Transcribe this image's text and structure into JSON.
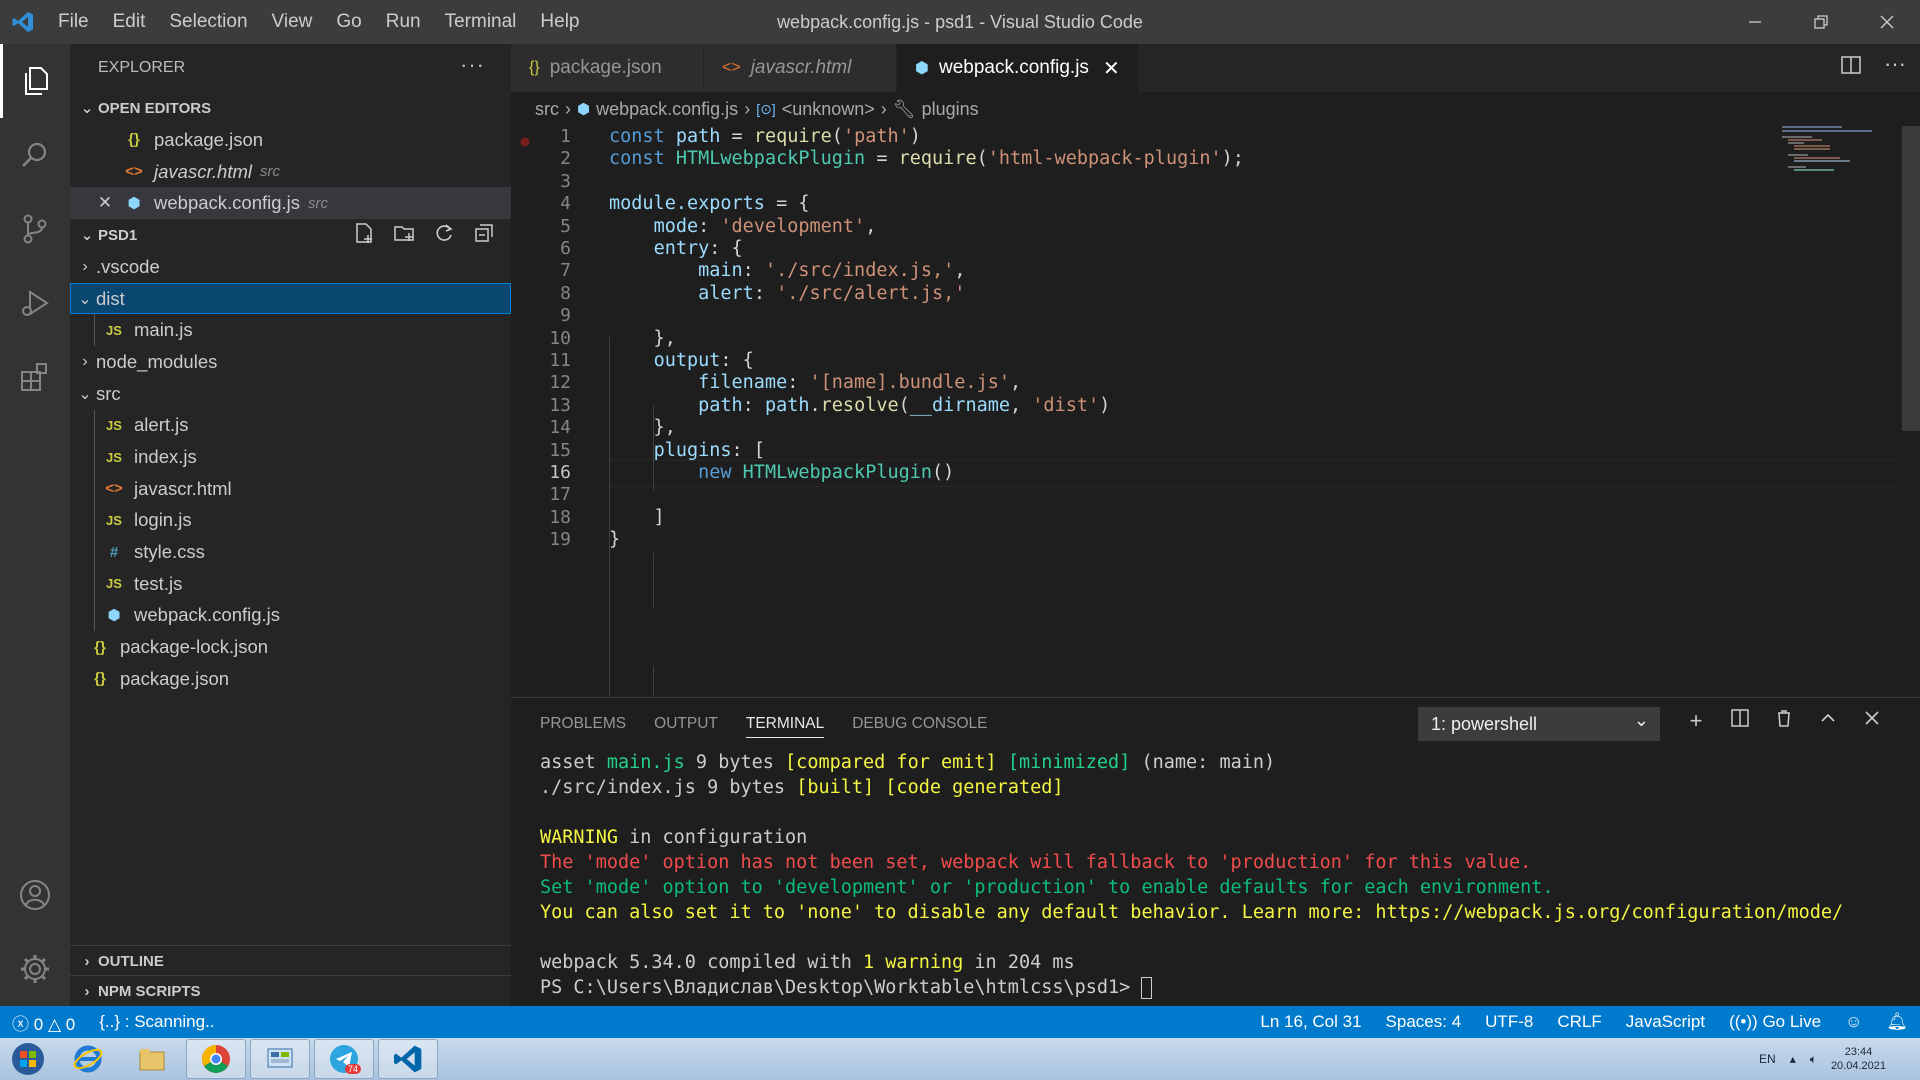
{
  "window": {
    "title": "webpack.config.js - psd1 - Visual Studio Code",
    "menu": [
      "File",
      "Edit",
      "Selection",
      "View",
      "Go",
      "Run",
      "Terminal",
      "Help"
    ]
  },
  "explorer": {
    "header": "EXPLORER",
    "open_editors_label": "OPEN EDITORS",
    "open_editors": [
      {
        "name": "package.json",
        "desc": "",
        "icon": "json"
      },
      {
        "name": "javascr.html",
        "desc": "src",
        "icon": "html"
      },
      {
        "name": "webpack.config.js",
        "desc": "src",
        "icon": "webpack"
      }
    ],
    "project_label": "PSD1",
    "tree": [
      {
        "name": ".vscode",
        "kind": "folder-closed"
      },
      {
        "name": "dist",
        "kind": "folder-open"
      },
      {
        "name": "main.js",
        "kind": "js"
      },
      {
        "name": "node_modules",
        "kind": "folder-closed"
      },
      {
        "name": "src",
        "kind": "folder-open"
      },
      {
        "name": "alert.js",
        "kind": "js"
      },
      {
        "name": "index.js",
        "kind": "js"
      },
      {
        "name": "javascr.html",
        "kind": "html"
      },
      {
        "name": "login.js",
        "kind": "js"
      },
      {
        "name": "style.css",
        "kind": "css"
      },
      {
        "name": "test.js",
        "kind": "js"
      },
      {
        "name": "webpack.config.js",
        "kind": "webpack"
      },
      {
        "name": "package-lock.json",
        "kind": "json"
      },
      {
        "name": "package.json",
        "kind": "json"
      }
    ],
    "outline_label": "OUTLINE",
    "npm_label": "NPM SCRIPTS"
  },
  "tabs": [
    {
      "name": "package.json",
      "icon": "json"
    },
    {
      "name": "javascr.html",
      "icon": "html"
    },
    {
      "name": "webpack.config.js",
      "icon": "webpack"
    }
  ],
  "breadcrumb": [
    "src",
    "webpack.config.js",
    "<unknown>",
    "plugins"
  ],
  "code": {
    "line_numbers": [
      "1",
      "2",
      "3",
      "4",
      "5",
      "6",
      "7",
      "8",
      "9",
      "10",
      "11",
      "12",
      "13",
      "14",
      "15",
      "16",
      "17",
      "18",
      "19"
    ],
    "lines": [
      "const path = require('path')",
      "const HTMLwebpackPlugin = require('html-webpack-plugin');",
      "",
      "module.exports = {",
      "    mode: 'development',",
      "    entry: {",
      "        main: './src/index.js,',",
      "        alert: './src/alert.js,'",
      "",
      "    },",
      "    output: {",
      "        filename: '[name].bundle.js',",
      "        path: path.resolve(__dirname, 'dist')",
      "    },",
      "    plugins: [",
      "        new HTMLwebpackPlugin()",
      "",
      "    ]",
      "}"
    ]
  },
  "panel": {
    "tabs": [
      "PROBLEMS",
      "OUTPUT",
      "TERMINAL",
      "DEBUG CONSOLE"
    ],
    "terminal_select": "1: powershell",
    "terminal_lines": [
      "asset main.js 9 bytes [compared for emit] [minimized] (name: main)",
      "./src/index.js 9 bytes [built] [code generated]",
      "",
      "WARNING in configuration",
      "The 'mode' option has not been set, webpack will fallback to 'production' for this value.",
      "Set 'mode' option to 'development' or 'production' to enable defaults for each environment.",
      "You can also set it to 'none' to disable any default behavior. Learn more: https://webpack.js.org/configuration/mode/",
      "",
      "webpack 5.34.0 compiled with 1 warning in 204 ms",
      "PS C:\\Users\\Владислав\\Desktop\\Worktable\\htmlcss\\psd1> "
    ]
  },
  "statusbar": {
    "errors": "0",
    "warnings": "0",
    "scanning": "{..} : Scanning..",
    "position": "Ln 16, Col 31",
    "spaces": "Spaces: 4",
    "encoding": "UTF-8",
    "eol": "CRLF",
    "language": "JavaScript",
    "golive": "Go Live"
  },
  "taskbar": {
    "lang": "EN",
    "time": "23:44",
    "date": "20.04.2021",
    "telegram_badge": "74"
  },
  "colors": {
    "accent": "#007acc",
    "selection": "#094771",
    "titlebar": "#3c3c3c"
  }
}
